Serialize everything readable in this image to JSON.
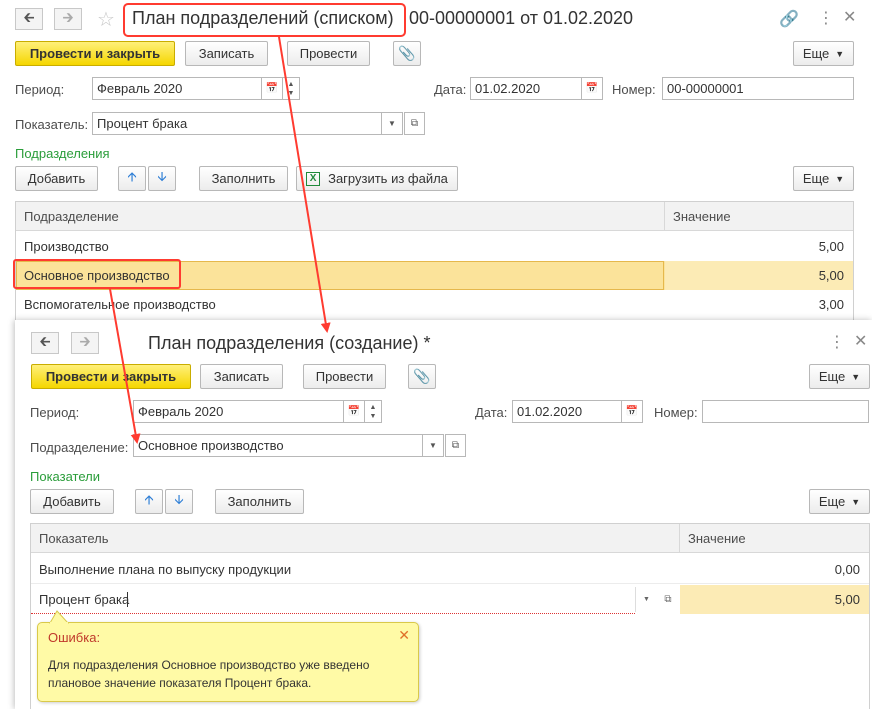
{
  "window1": {
    "title": "План подразделений (списком)",
    "title_suffix": "00-00000001 от 01.02.2020",
    "toolbar": {
      "post_close": "Провести и закрыть",
      "save": "Записать",
      "post": "Провести",
      "more": "Еще"
    },
    "fields": {
      "period_label": "Период:",
      "period_value": "Февраль 2020",
      "date_label": "Дата:",
      "date_value": "01.02.2020",
      "number_label": "Номер:",
      "number_value": "00-00000001",
      "indicator_label": "Показатель:",
      "indicator_value": "Процент брака"
    },
    "section": "Подразделения",
    "table_toolbar": {
      "add": "Добавить",
      "fill": "Заполнить",
      "load": "Загрузить из файла",
      "more": "Еще"
    },
    "columns": [
      "Подразделение",
      "Значение"
    ],
    "rows": [
      {
        "name": "Производство",
        "value": "5,00"
      },
      {
        "name": "Основное производство",
        "value": "5,00"
      },
      {
        "name": "Вспомогательное производство",
        "value": "3,00"
      }
    ]
  },
  "window2": {
    "title": "План подразделения (создание) *",
    "toolbar": {
      "post_close": "Провести и закрыть",
      "save": "Записать",
      "post": "Провести",
      "more": "Еще"
    },
    "fields": {
      "period_label": "Период:",
      "period_value": "Февраль 2020",
      "date_label": "Дата:",
      "date_value": "01.02.2020",
      "number_label": "Номер:",
      "number_value": "",
      "division_label": "Подразделение:",
      "division_value": "Основное производство"
    },
    "section": "Показатели",
    "table_toolbar": {
      "add": "Добавить",
      "fill": "Заполнить",
      "more": "Еще"
    },
    "columns": [
      "Показатель",
      "Значение"
    ],
    "rows": [
      {
        "name": "Выполнение плана по выпуску продукции",
        "value": "0,00"
      },
      {
        "name": "Процент брака",
        "value": "5,00"
      }
    ],
    "error": {
      "title": "Ошибка:",
      "message_line1": "Для подразделения Основное производство уже введено",
      "message_line2": "плановое значение показателя Процент брака."
    }
  },
  "colors": {
    "highlight": "#ff3b30",
    "primary_button": "#f5d600",
    "section": "#2a9d3a",
    "selected_row": "#fbe39a",
    "error_bg": "#fffaa6"
  }
}
